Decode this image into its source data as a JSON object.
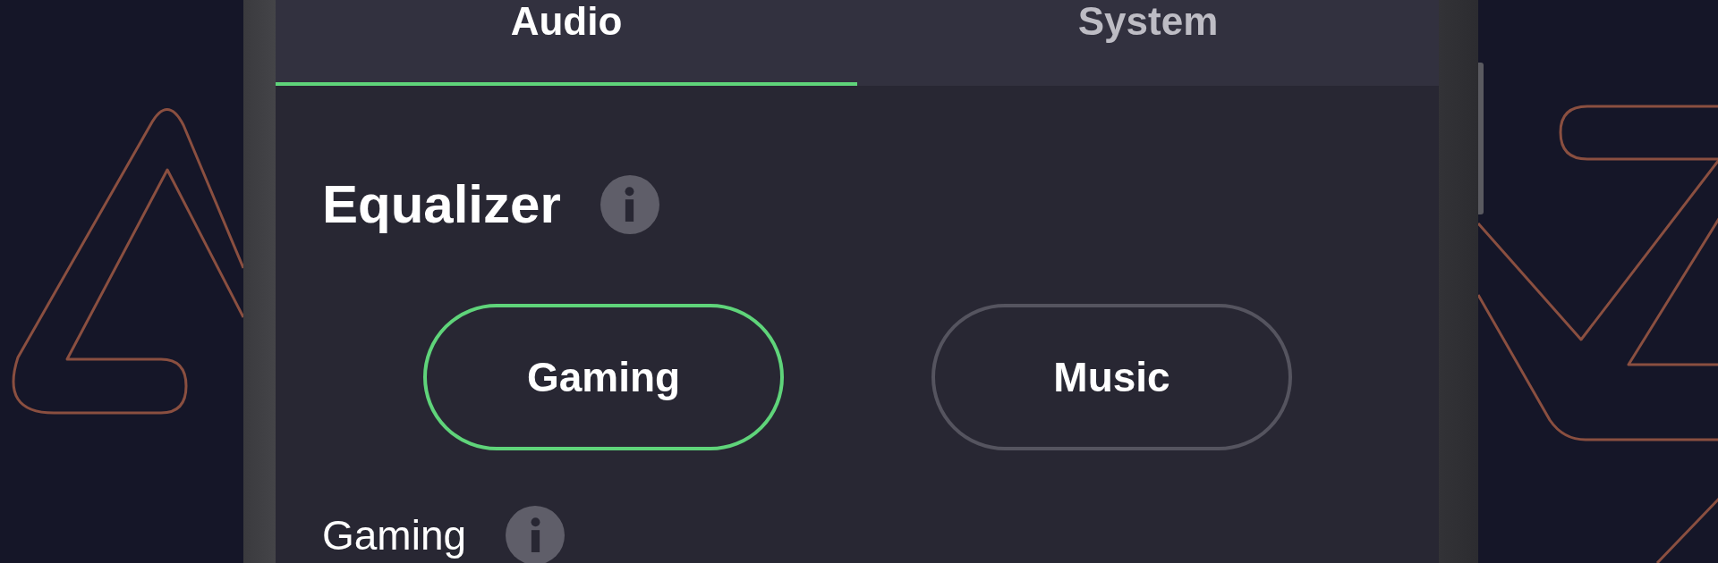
{
  "tabs": [
    {
      "label": "Audio",
      "selected": true
    },
    {
      "label": "System",
      "selected": false
    }
  ],
  "equalizer": {
    "title": "Equalizer",
    "presets": [
      {
        "label": "Gaming",
        "selected": true
      },
      {
        "label": "Music",
        "selected": false
      }
    ]
  },
  "section": {
    "title": "Gaming"
  }
}
